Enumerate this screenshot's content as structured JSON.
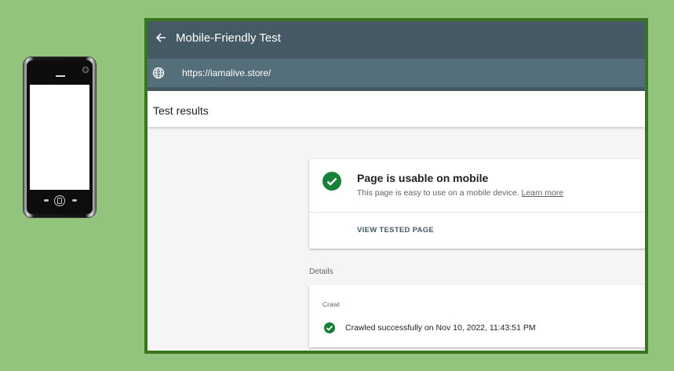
{
  "phone": {
    "icon": "mobile-phone-illustration"
  },
  "window": {
    "title": "Mobile-Friendly Test",
    "back_icon": "arrow-left-icon",
    "url": "https://iamalive.store/",
    "globe_icon": "globe-icon"
  },
  "results": {
    "title": "Test results",
    "usable_card": {
      "icon": "check-circle-icon",
      "title": "Page is usable on mobile",
      "description": "This page is easy to use on a mobile device.",
      "learn_more": "Learn more",
      "action": "VIEW TESTED PAGE"
    },
    "details_label": "Details",
    "crawl_card": {
      "label": "Crawl",
      "icon": "check-circle-icon",
      "status": "Crawled successfully on Nov 10, 2022, 11:43:51 PM"
    }
  },
  "colors": {
    "background": "#93c47d",
    "window_border": "#38761d",
    "topbar": "#455a64",
    "urlbar": "#546e7a",
    "success": "#188038"
  }
}
